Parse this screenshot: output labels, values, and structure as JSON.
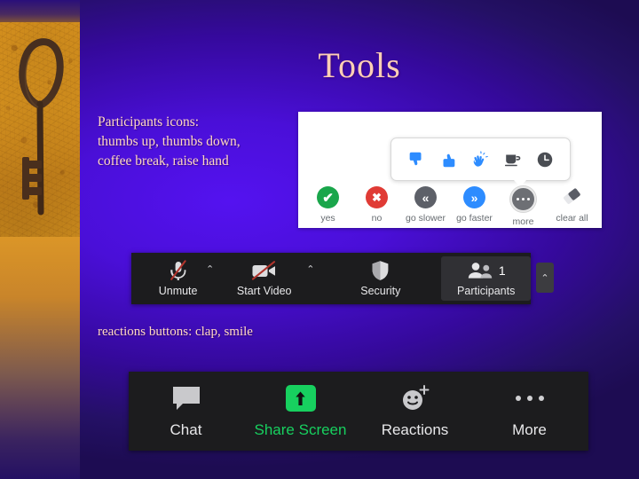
{
  "slide": {
    "title": "Tools",
    "theme": {
      "accent_text": "#ffd9c2",
      "title_color": "#ffcfb5",
      "background_purple": "#4a0fd8",
      "sidebar_orange": "#e0991f",
      "toolbar_dark": "#1c1c1e"
    }
  },
  "sidebar": {
    "image_name": "antique-key-photo"
  },
  "captions": {
    "participants": "Participants icons:\nthumbs up, thumbs down,\ncoffee break, raise hand",
    "reactions": "reactions buttons: clap, smile"
  },
  "reactions_panel": {
    "tooltip_icons": [
      {
        "name": "thumbs-down-icon",
        "color": "#2d8cff"
      },
      {
        "name": "thumbs-up-icon",
        "color": "#2d8cff"
      },
      {
        "name": "clapping-hands-icon",
        "color": "#2d8cff"
      },
      {
        "name": "coffee-cup-icon",
        "color": "#4a4d53"
      },
      {
        "name": "clock-icon",
        "color": "#4a4d53"
      }
    ],
    "status_items": [
      {
        "label": "yes",
        "icon": "check-circle-icon",
        "color": "#1aa64b",
        "glyph": "✔"
      },
      {
        "label": "no",
        "icon": "x-circle-icon",
        "color": "#e03b35",
        "glyph": "✖"
      },
      {
        "label": "go slower",
        "icon": "double-chevron-left-icon",
        "color": "#5d6068",
        "glyph": "«"
      },
      {
        "label": "go faster",
        "icon": "double-chevron-right-icon",
        "color": "#2d8cff",
        "glyph": "»"
      },
      {
        "label": "more",
        "icon": "more-dots-circle-icon",
        "color": "#6d6f74",
        "glyph": ""
      },
      {
        "label": "clear all",
        "icon": "eraser-icon",
        "color": "#5a5d66",
        "glyph": ""
      }
    ]
  },
  "toolbar_controls": {
    "items": [
      {
        "label": "Unmute",
        "icon": "microphone-muted-icon",
        "caret": "⌃"
      },
      {
        "label": "Start Video",
        "icon": "camera-muted-icon",
        "caret": "⌃"
      },
      {
        "label": "Security",
        "icon": "shield-icon",
        "caret": ""
      },
      {
        "label": "Participants",
        "icon": "participants-icon",
        "caret": "⌃",
        "count": "1"
      }
    ]
  },
  "toolbar_actions": {
    "items": [
      {
        "label": "Chat",
        "icon": "chat-bubble-icon",
        "color": "#e8e8ea"
      },
      {
        "label": "Share Screen",
        "icon": "share-screen-icon",
        "color": "#17d05f"
      },
      {
        "label": "Reactions",
        "icon": "reactions-smiley-icon",
        "color": "#e8e8ea"
      },
      {
        "label": "More",
        "icon": "more-dots-icon",
        "color": "#e8e8ea"
      }
    ]
  }
}
